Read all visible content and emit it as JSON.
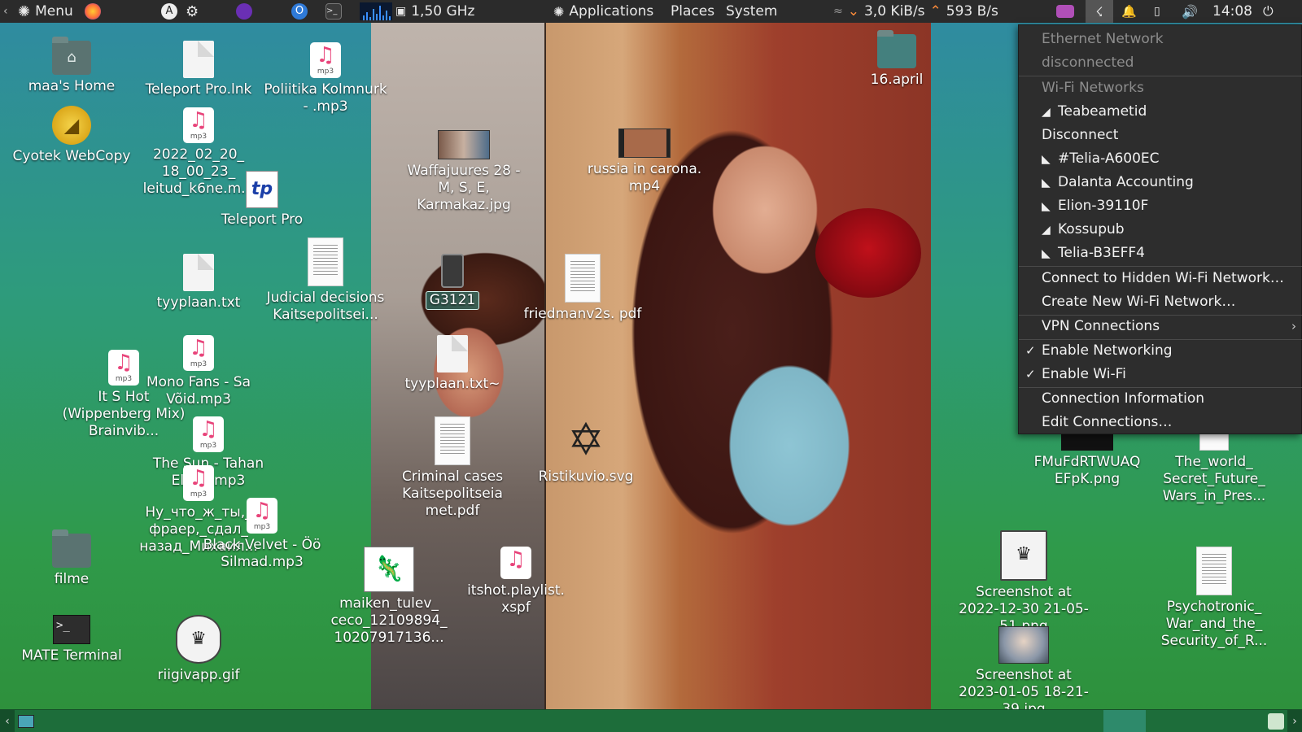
{
  "top_panel": {
    "menu_label": "Menu",
    "cpu_freq": "1,50 GHz",
    "applications": "Applications",
    "places": "Places",
    "system": "System",
    "net_down": "3,0 KiB/s",
    "net_up": "593 B/s",
    "clock": "14:08"
  },
  "desktop_icons": {
    "home": "maa's Home",
    "teleport_lnk": "Teleport Pro.lnk",
    "poliitika": "Poliitika Kolmnurk - .mp3",
    "folder_16april": "16.april",
    "cyotek": "Cyotek WebCopy",
    "mp3_2022": "2022_02_20_ 18_00_23_ leitud_k6ne.m...",
    "teleport_pro": "Teleport Pro",
    "waffajuures": "Waffajuures 28 - M, S, E, Karmakaz.jpg",
    "russia": "russia in carona. mp4",
    "tyyplaan": "tyyplaan.txt",
    "judicial": "Judicial decisions Kaitsepolitsei...",
    "g3121": "G3121",
    "friedman": "friedmanv2s. pdf",
    "itshot": "It S Hot (Wippenberg Mix)  Brainvib...",
    "mono_fans": "Mono Fans - Sa Võid.mp3",
    "tyyplaan_tilde": "tyyplaan.txt~",
    "the_sun": "The Sun - Tahan Elada.mp3",
    "ny_chto": "Ну_что_ж_ты,_ фраер,_сдал_ назад_Михаил...",
    "criminal": "Criminal cases Kaitsepolitseia met.pdf",
    "ristikuvio": "Ristikuvio.svg",
    "black_velvet": "Black Velvet - Öö Silmad.mp3",
    "filme": "filme",
    "maiken": "maiken_tulev_ ceco_12109894_ 10207917136...",
    "itshot_playlist": "itshot.playlist. xspf",
    "mate_terminal": "MATE Terminal",
    "riigivapp": "riigivapp.gif",
    "fmufd": "FMuFdRTWUAQ EFpK.png",
    "the_world": "The_world_ Secret_Future_ Wars_in_Pres...",
    "screenshot_2022": "Screenshot at 2022-12-30 21-05-51.png",
    "screenshot_2023": "Screenshot at 2023-01-05 18-21-39.jpg",
    "psychotronic": "Psychotronic_ War_and_the_ Security_of_R..."
  },
  "network_menu": {
    "ethernet_header": "Ethernet Network",
    "ethernet_status": "disconnected",
    "wifi_header": "Wi-Fi Networks",
    "networks": [
      "Teabeametid",
      "Disconnect",
      "#Telia-A600EC",
      "Dalanta Accounting",
      "Elion-39110F",
      "Kossupub",
      "Telia-B3EFF4"
    ],
    "connect_hidden": "Connect to Hidden Wi-Fi Network…",
    "create_new": "Create New Wi-Fi Network…",
    "vpn": "VPN Connections",
    "enable_networking": "Enable Networking",
    "enable_wifi": "Enable Wi-Fi",
    "connection_info": "Connection Information",
    "edit_connections": "Edit Connections…"
  }
}
